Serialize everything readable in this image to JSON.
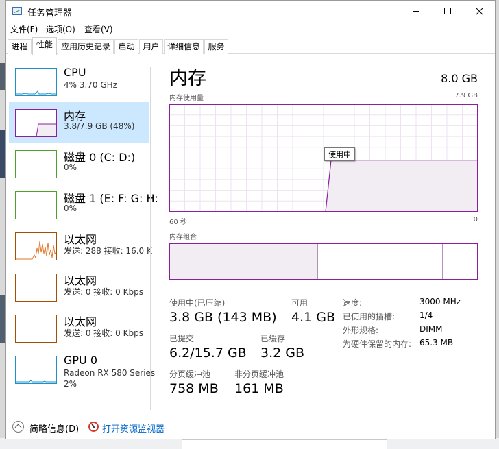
{
  "window": {
    "title": "任务管理器",
    "menu": [
      "文件(F)",
      "选项(O)",
      "查看(V)"
    ],
    "tabs": [
      "进程",
      "性能",
      "应用历史记录",
      "启动",
      "用户",
      "详细信息",
      "服务"
    ],
    "active_tab": "性能"
  },
  "sidebar": {
    "items": [
      {
        "title": "CPU",
        "sub": "4% 3.70 GHz",
        "sub2": "",
        "icon": "cpu-graph",
        "color": "#1e91c8"
      },
      {
        "title": "内存",
        "sub": "3.8/7.9 GB (48%)",
        "sub2": "",
        "icon": "memory-graph",
        "color": "#8b1fa0",
        "selected": true
      },
      {
        "title": "磁盘 0 (C: D:)",
        "sub": "0%",
        "sub2": "",
        "icon": "disk-graph",
        "color": "#4ca22b"
      },
      {
        "title": "磁盘 1 (E: F: G: H:",
        "sub": "0%",
        "sub2": "",
        "icon": "disk-graph",
        "color": "#4ca22b"
      },
      {
        "title": "以太网",
        "sub": "发送: 288 接收: 16.0 K",
        "sub2": "",
        "icon": "network-graph",
        "color": "#a74f01"
      },
      {
        "title": "以太网",
        "sub": "发送: 0 接收: 0 Kbps",
        "sub2": "",
        "icon": "network-graph",
        "color": "#a74f01"
      },
      {
        "title": "以太网",
        "sub": "发送: 0 接收: 0 Kbps",
        "sub2": "",
        "icon": "network-graph",
        "color": "#a74f01"
      },
      {
        "title": "GPU 0",
        "sub": "Radeon RX 580 Series",
        "sub2": "2%",
        "icon": "gpu-graph",
        "color": "#1e91c8"
      }
    ]
  },
  "memory": {
    "title": "内存",
    "total": "8.0 GB",
    "usage_label": "内存使用量",
    "usage_max": "7.9 GB",
    "time_left": "60 秒",
    "time_right": "0",
    "tooltip": "使用中",
    "composition_label": "内存组合",
    "stats": {
      "in_use_label": "使用中(已压缩)",
      "in_use": "3.8 GB (143 MB)",
      "available_label": "可用",
      "available": "4.1 GB",
      "committed_label": "已提交",
      "committed": "6.2/15.7 GB",
      "cached_label": "已缓存",
      "cached": "3.2 GB",
      "paged_label": "分页缓冲池",
      "paged": "758 MB",
      "nonpaged_label": "非分页缓冲池",
      "nonpaged": "161 MB"
    },
    "details": [
      {
        "label": "速度:",
        "value": "3000 MHz"
      },
      {
        "label": "已使用的插槽:",
        "value": "1/4"
      },
      {
        "label": "外形规格:",
        "value": "DIMM"
      },
      {
        "label": "为硬件保留的内存:",
        "value": "65.3 MB"
      }
    ],
    "usage_fraction": 0.48,
    "accent": "#8b1fa0",
    "fill": "#f1edf2"
  },
  "footer": {
    "brief": "简略信息(D)",
    "monitor": "打开资源监视器"
  }
}
